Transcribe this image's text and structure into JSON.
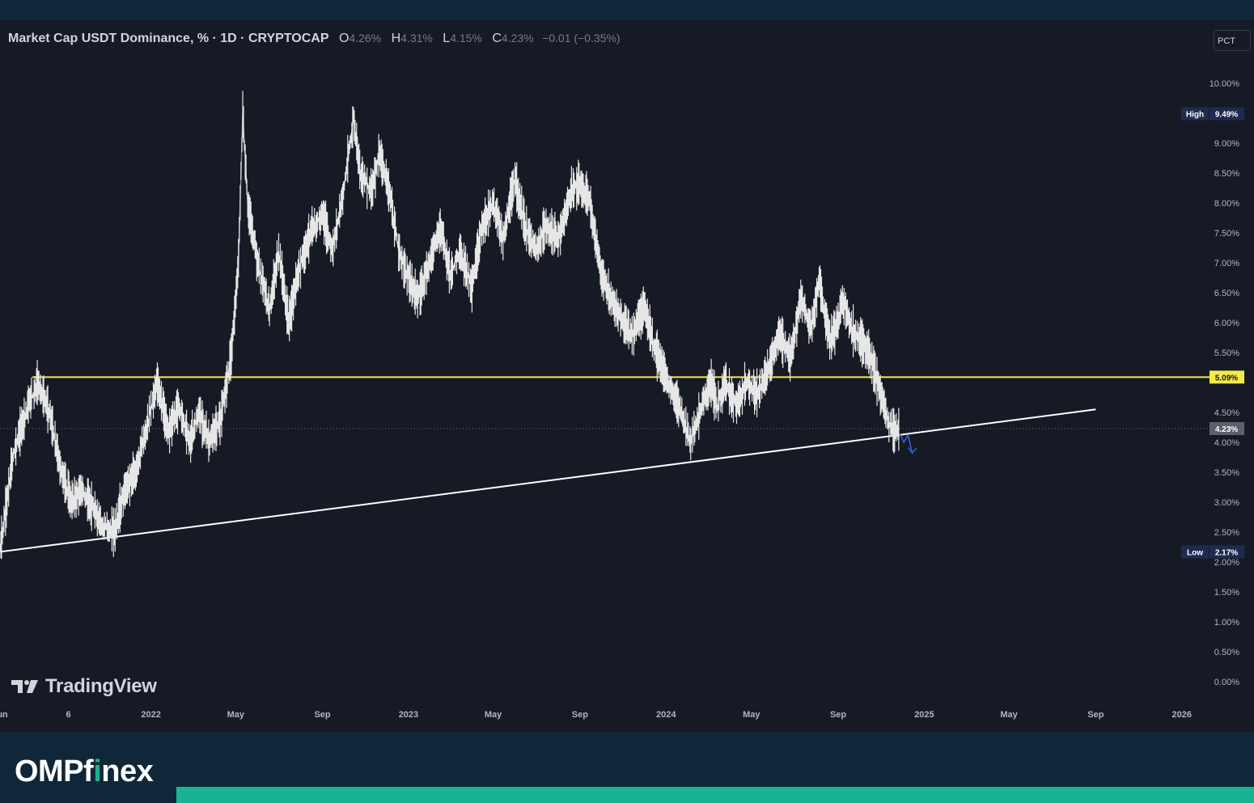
{
  "legend": {
    "title": "Market Cap USDT Dominance, % · 1D · CRYPTOCAP",
    "o_label": "O",
    "o_value": "4.26%",
    "h_label": "H",
    "h_value": "4.31%",
    "l_label": "L",
    "l_value": "4.15%",
    "c_label": "C",
    "c_value": "4.23%",
    "change": "−0.01 (−0.35%)"
  },
  "scale_button": "PCT",
  "watermark": "TradingView",
  "brand": {
    "part1": "OMPf",
    "part2": "i",
    "part3": "nex"
  },
  "colors": {
    "background": "#161a25",
    "frame": "#0f2738",
    "price": "#e6e6e6",
    "horizontal_line": "#f5e94a",
    "trendline": "#ffffff",
    "arrow": "#2f5fd0",
    "brand_accent": "#19b394"
  },
  "chart_data": {
    "type": "candlestick",
    "ylim": [
      0,
      10
    ],
    "x_range": [
      "2021-06-01",
      "2026-02-15"
    ],
    "y_ticks": [
      "10.00%",
      "9.00%",
      "8.50%",
      "8.00%",
      "7.50%",
      "7.00%",
      "6.50%",
      "6.00%",
      "5.50%",
      "4.50%",
      "4.00%",
      "3.50%",
      "3.00%",
      "2.50%",
      "2.00%",
      "1.50%",
      "1.00%",
      "0.50%",
      "0.00%"
    ],
    "x_ticks": [
      {
        "label": "Jun",
        "date": "2021-06-01"
      },
      {
        "label": "6",
        "date": "2021-09-06"
      },
      {
        "label": "2022",
        "date": "2022-01-01"
      },
      {
        "label": "May",
        "date": "2022-05-01"
      },
      {
        "label": "Sep",
        "date": "2022-09-01"
      },
      {
        "label": "2023",
        "date": "2023-01-01"
      },
      {
        "label": "May",
        "date": "2023-05-01"
      },
      {
        "label": "Sep",
        "date": "2023-09-01"
      },
      {
        "label": "2024",
        "date": "2024-01-01"
      },
      {
        "label": "May",
        "date": "2024-05-01"
      },
      {
        "label": "Sep",
        "date": "2024-09-01"
      },
      {
        "label": "2025",
        "date": "2025-01-01"
      },
      {
        "label": "May",
        "date": "2025-05-01"
      },
      {
        "label": "Sep",
        "date": "2025-09-01"
      },
      {
        "label": "2026",
        "date": "2026-01-01"
      }
    ],
    "price_series": {
      "dates": [
        "2021-06-01",
        "2021-06-20",
        "2021-07-10",
        "2021-07-25",
        "2021-08-10",
        "2021-08-25",
        "2021-09-10",
        "2021-09-25",
        "2021-10-10",
        "2021-10-25",
        "2021-11-10",
        "2021-11-25",
        "2021-12-10",
        "2021-12-25",
        "2022-01-10",
        "2022-01-25",
        "2022-02-10",
        "2022-02-25",
        "2022-03-10",
        "2022-03-25",
        "2022-04-10",
        "2022-04-25",
        "2022-05-05",
        "2022-05-11",
        "2022-05-18",
        "2022-06-01",
        "2022-06-18",
        "2022-07-01",
        "2022-07-15",
        "2022-08-01",
        "2022-08-15",
        "2022-09-01",
        "2022-09-15",
        "2022-10-01",
        "2022-10-15",
        "2022-10-25",
        "2022-11-09",
        "2022-11-21",
        "2022-12-05",
        "2022-12-18",
        "2022-12-30",
        "2023-01-15",
        "2023-01-30",
        "2023-02-15",
        "2023-03-01",
        "2023-03-15",
        "2023-04-01",
        "2023-04-15",
        "2023-05-01",
        "2023-05-15",
        "2023-06-01",
        "2023-06-15",
        "2023-07-01",
        "2023-07-15",
        "2023-08-01",
        "2023-08-20",
        "2023-09-01",
        "2023-09-15",
        "2023-10-01",
        "2023-10-15",
        "2023-11-01",
        "2023-11-15",
        "2023-12-01",
        "2023-12-15",
        "2024-01-03",
        "2024-01-20",
        "2024-02-05",
        "2024-02-20",
        "2024-03-05",
        "2024-03-14",
        "2024-03-25",
        "2024-04-10",
        "2024-04-25",
        "2024-05-10",
        "2024-05-25",
        "2024-06-10",
        "2024-06-25",
        "2024-07-10",
        "2024-07-25",
        "2024-08-05",
        "2024-08-20",
        "2024-09-01",
        "2024-09-07",
        "2024-09-20",
        "2024-10-05",
        "2024-10-20",
        "2024-11-01",
        "2024-11-12",
        "2024-11-20",
        "2024-11-27"
      ],
      "values": [
        2.2,
        3.8,
        4.6,
        5.0,
        4.5,
        3.6,
        3.0,
        3.2,
        2.9,
        2.6,
        2.5,
        3.2,
        3.5,
        4.2,
        5.0,
        4.2,
        4.6,
        4.0,
        4.5,
        4.0,
        4.4,
        5.5,
        7.0,
        9.5,
        8.0,
        7.0,
        6.2,
        7.2,
        6.0,
        7.0,
        7.5,
        7.8,
        7.2,
        8.2,
        9.4,
        8.5,
        8.2,
        8.8,
        8.2,
        7.2,
        6.8,
        6.4,
        7.0,
        7.6,
        6.8,
        7.2,
        6.6,
        7.6,
        8.0,
        7.4,
        8.4,
        7.6,
        7.2,
        7.6,
        7.4,
        8.2,
        8.3,
        8.0,
        6.8,
        6.4,
        6.0,
        5.8,
        6.3,
        5.6,
        5.0,
        4.6,
        4.0,
        4.6,
        5.0,
        4.6,
        5.0,
        4.6,
        5.0,
        4.8,
        5.2,
        5.8,
        5.4,
        6.4,
        5.9,
        6.7,
        5.7,
        6.0,
        6.4,
        5.9,
        5.7,
        5.3,
        4.8,
        4.3,
        4.2,
        4.23
      ]
    },
    "last_price": 4.23,
    "high": {
      "label": "High",
      "value": "9.49%"
    },
    "low": {
      "label": "Low",
      "value": "2.17%"
    },
    "horizontal_level": {
      "value": 5.09,
      "label": "5.09%"
    },
    "last_label": "4.23%",
    "trendline": {
      "start": [
        "2021-06-01",
        2.17
      ],
      "end": [
        "2025-09-01",
        4.55
      ]
    },
    "projection_arrow": [
      [
        "2024-11-27",
        4.15
      ],
      [
        "2024-12-03",
        4.0
      ],
      [
        "2024-12-09",
        4.12
      ],
      [
        "2024-12-15",
        3.82
      ]
    ],
    "grid": false
  }
}
